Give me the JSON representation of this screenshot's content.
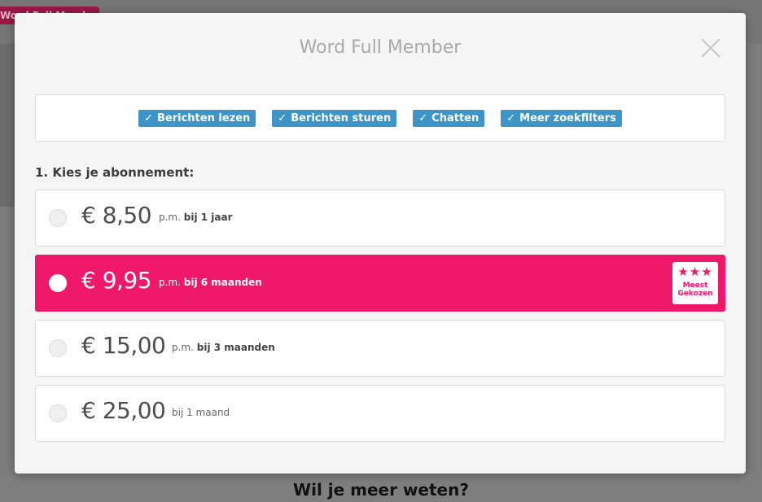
{
  "background": {
    "tag_label": "Word Full Member",
    "footer_title": "Wil je meer weten?"
  },
  "modal": {
    "title": "Word Full Member",
    "features": [
      {
        "icon": "check-icon",
        "label": "Berichten lezen"
      },
      {
        "icon": "check-icon",
        "label": "Berichten sturen"
      },
      {
        "icon": "check-icon",
        "label": "Chatten"
      },
      {
        "icon": "check-icon",
        "label": "Meer zoekfilters"
      }
    ],
    "section_label": "1. Kies je abonnement:",
    "plans": [
      {
        "price": "€ 8,50",
        "term_prefix": "p.m.",
        "term": "bij 1 jaar",
        "selected": false
      },
      {
        "price": "€ 9,95",
        "term_prefix": "p.m.",
        "term": "bij 6 maanden",
        "selected": true
      },
      {
        "price": "€ 15,00",
        "term_prefix": "p.m.",
        "term": "bij 3 maanden",
        "selected": false
      },
      {
        "price": "€ 25,00",
        "term_prefix": "",
        "term": "bij 1 maand",
        "selected": false
      }
    ],
    "badge": {
      "stars": "★★★",
      "line1": "Meest",
      "line2": "Gekozen"
    }
  },
  "colors": {
    "accent_pink": "#f0186b",
    "feature_blue": "#3d95c7"
  }
}
